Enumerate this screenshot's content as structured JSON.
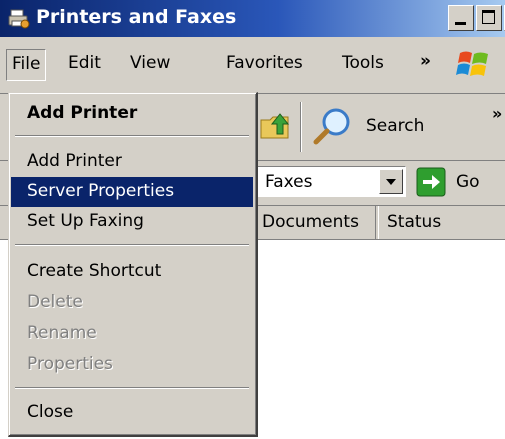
{
  "window": {
    "title": "Printers and Faxes"
  },
  "menubar": {
    "items": [
      {
        "label": "File"
      },
      {
        "label": "Edit"
      },
      {
        "label": "View"
      },
      {
        "label": "Favorites"
      },
      {
        "label": "Tools"
      }
    ],
    "chevron": "»"
  },
  "toolbar": {
    "search_label": "Search",
    "chevron": "»"
  },
  "addressbar": {
    "value": "Faxes",
    "go_label": "Go"
  },
  "columns": [
    {
      "label": "Documents"
    },
    {
      "label": "Status"
    }
  ],
  "file_menu": {
    "items": [
      {
        "label": "Add Printer",
        "style": "bold"
      },
      {
        "label": "Add Printer"
      },
      {
        "label": "Server Properties",
        "state": "highlighted"
      },
      {
        "label": "Set Up Faxing"
      },
      {
        "label": "Create Shortcut"
      },
      {
        "label": "Delete",
        "state": "disabled"
      },
      {
        "label": "Rename",
        "state": "disabled"
      },
      {
        "label": "Properties",
        "state": "disabled"
      },
      {
        "label": "Close"
      }
    ]
  },
  "colors": {
    "title_bar_start": "#0a246a",
    "title_bar_end": "#a6caf0",
    "menu_face": "#d4d0c8",
    "highlight": "#0a246a",
    "disabled_text": "#808080"
  },
  "icons": {
    "title": "printer-fax-icon",
    "brand": "windows-logo-icon",
    "up": "folder-up-icon",
    "search": "search-magnifier-icon",
    "go": "go-arrow-icon"
  }
}
